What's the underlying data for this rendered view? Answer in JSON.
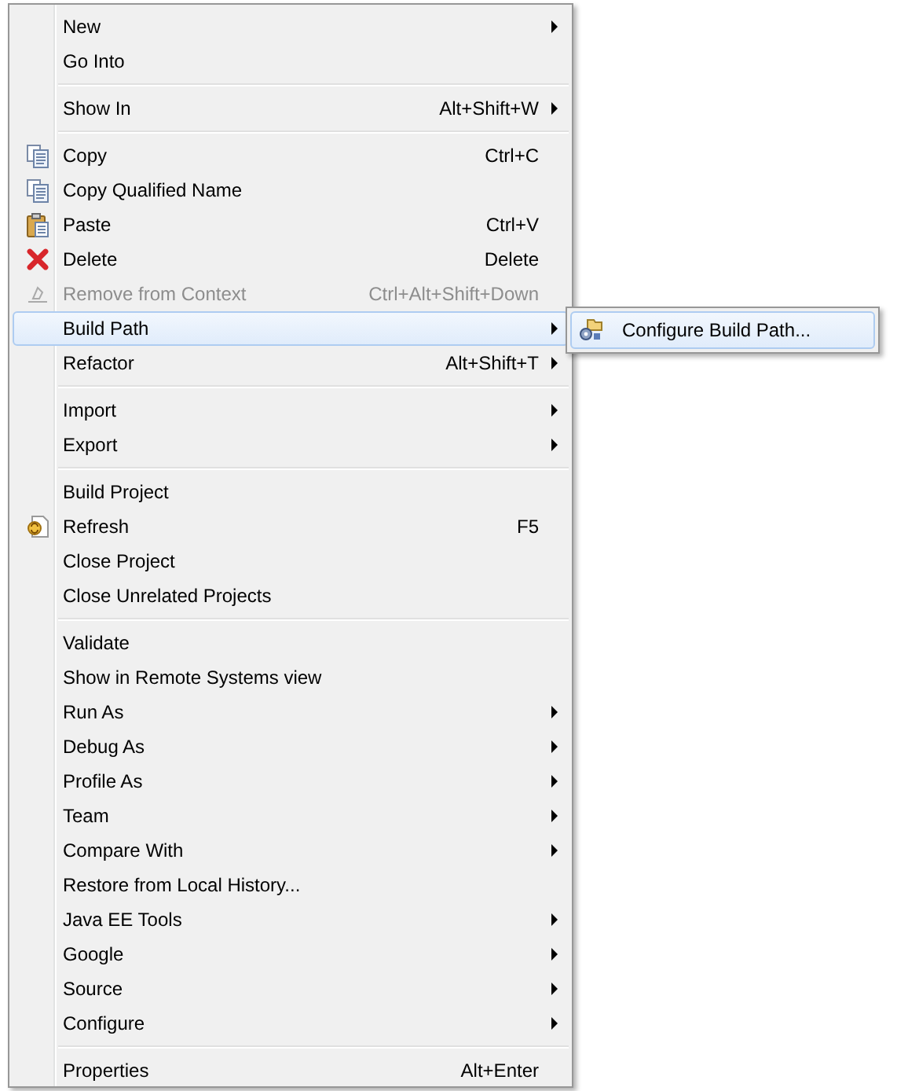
{
  "context_menu": {
    "items": [
      {
        "kind": "item",
        "label": "New",
        "submenu_arrow": true,
        "disabled": false,
        "selected": false
      },
      {
        "kind": "item",
        "label": "Go Into",
        "submenu_arrow": false,
        "disabled": false,
        "selected": false
      },
      {
        "kind": "separator"
      },
      {
        "kind": "item",
        "label": "Show In",
        "shortcut": "Alt+Shift+W",
        "submenu_arrow": true,
        "disabled": false,
        "selected": false
      },
      {
        "kind": "separator"
      },
      {
        "kind": "item",
        "label": "Copy",
        "shortcut": "Ctrl+C",
        "submenu_arrow": false,
        "disabled": false,
        "selected": false
      },
      {
        "kind": "item",
        "label": "Copy Qualified Name",
        "submenu_arrow": false,
        "disabled": false,
        "selected": false
      },
      {
        "kind": "item",
        "label": "Paste",
        "shortcut": "Ctrl+V",
        "submenu_arrow": false,
        "disabled": false,
        "selected": false
      },
      {
        "kind": "item",
        "label": "Delete",
        "shortcut": "Delete",
        "submenu_arrow": false,
        "disabled": false,
        "selected": false
      },
      {
        "kind": "item",
        "label": "Remove from Context",
        "shortcut": "Ctrl+Alt+Shift+Down",
        "submenu_arrow": false,
        "disabled": true,
        "selected": false
      },
      {
        "kind": "item",
        "label": "Build Path",
        "submenu_arrow": true,
        "disabled": false,
        "selected": true,
        "submenu": [
          {
            "label": "Configure Build Path...",
            "selected": true
          }
        ]
      },
      {
        "kind": "item",
        "label": "Refactor",
        "shortcut": "Alt+Shift+T",
        "submenu_arrow": true,
        "disabled": false,
        "selected": false
      },
      {
        "kind": "separator"
      },
      {
        "kind": "item",
        "label": "Import",
        "submenu_arrow": true,
        "disabled": false,
        "selected": false
      },
      {
        "kind": "item",
        "label": "Export",
        "submenu_arrow": true,
        "disabled": false,
        "selected": false
      },
      {
        "kind": "separator"
      },
      {
        "kind": "item",
        "label": "Build Project",
        "submenu_arrow": false,
        "disabled": false,
        "selected": false
      },
      {
        "kind": "item",
        "label": "Refresh",
        "shortcut": "F5",
        "submenu_arrow": false,
        "disabled": false,
        "selected": false
      },
      {
        "kind": "item",
        "label": "Close Project",
        "submenu_arrow": false,
        "disabled": false,
        "selected": false
      },
      {
        "kind": "item",
        "label": "Close Unrelated Projects",
        "submenu_arrow": false,
        "disabled": false,
        "selected": false
      },
      {
        "kind": "separator"
      },
      {
        "kind": "item",
        "label": "Validate",
        "submenu_arrow": false,
        "disabled": false,
        "selected": false
      },
      {
        "kind": "item",
        "label": "Show in Remote Systems view",
        "submenu_arrow": false,
        "disabled": false,
        "selected": false
      },
      {
        "kind": "item",
        "label": "Run As",
        "submenu_arrow": true,
        "disabled": false,
        "selected": false
      },
      {
        "kind": "item",
        "label": "Debug As",
        "submenu_arrow": true,
        "disabled": false,
        "selected": false
      },
      {
        "kind": "item",
        "label": "Profile As",
        "submenu_arrow": true,
        "disabled": false,
        "selected": false
      },
      {
        "kind": "item",
        "label": "Team",
        "submenu_arrow": true,
        "disabled": false,
        "selected": false
      },
      {
        "kind": "item",
        "label": "Compare With",
        "submenu_arrow": true,
        "disabled": false,
        "selected": false
      },
      {
        "kind": "item",
        "label": "Restore from Local History...",
        "submenu_arrow": false,
        "disabled": false,
        "selected": false
      },
      {
        "kind": "item",
        "label": "Java EE Tools",
        "submenu_arrow": true,
        "disabled": false,
        "selected": false
      },
      {
        "kind": "item",
        "label": "Google",
        "submenu_arrow": true,
        "disabled": false,
        "selected": false
      },
      {
        "kind": "item",
        "label": "Source",
        "submenu_arrow": true,
        "disabled": false,
        "selected": false
      },
      {
        "kind": "item",
        "label": "Configure",
        "submenu_arrow": true,
        "disabled": false,
        "selected": false
      },
      {
        "kind": "separator"
      },
      {
        "kind": "item",
        "label": "Properties",
        "shortcut": "Alt+Enter",
        "submenu_arrow": false,
        "disabled": false,
        "selected": false
      }
    ]
  }
}
